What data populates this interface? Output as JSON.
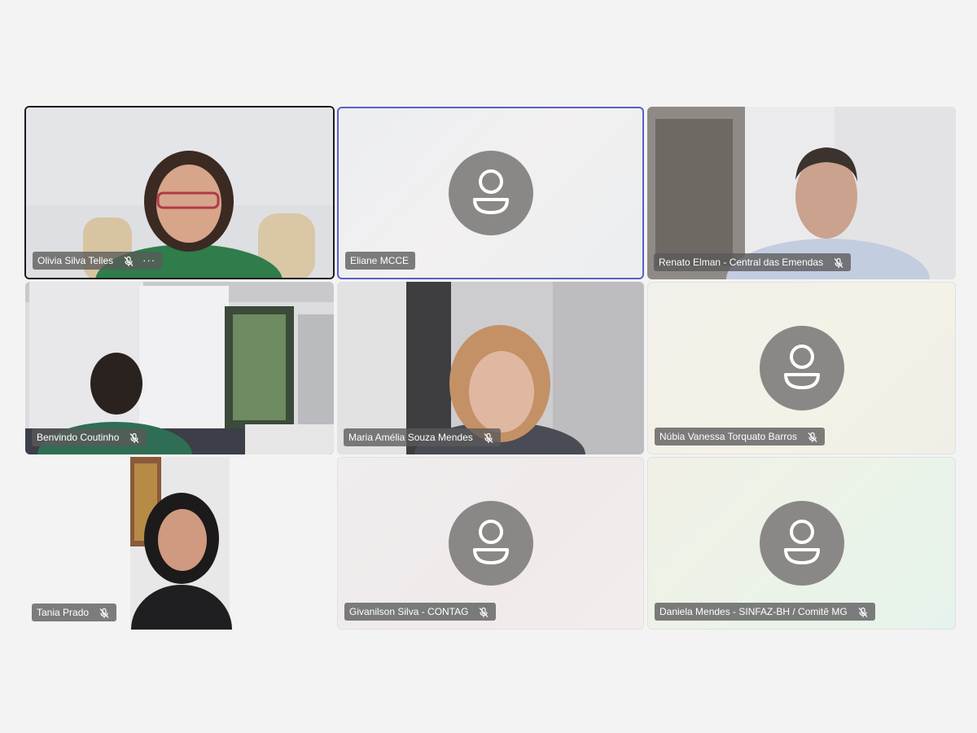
{
  "meeting": {
    "participants": [
      {
        "name": "Olivia Silva Telles",
        "muted": true,
        "more_label": "···",
        "state": "active"
      },
      {
        "name": "Eliane MCCE",
        "muted": false,
        "state": "speaking"
      },
      {
        "name": "Renato Elman - Central das Emendas",
        "muted": true,
        "state": "video"
      },
      {
        "name": "Benvindo Coutinho",
        "muted": true,
        "state": "video"
      },
      {
        "name": "Maria Amélia Souza Mendes",
        "muted": true,
        "state": "video"
      },
      {
        "name": "Núbia Vanessa Torquato Barros",
        "muted": true,
        "state": "avatar"
      },
      {
        "name": "Tania Prado",
        "muted": true,
        "state": "video"
      },
      {
        "name": "Givanilson Silva - CONTAG",
        "muted": true,
        "state": "avatar"
      },
      {
        "name": "Daniela Mendes - SINFAZ-BH / Comitê MG",
        "muted": true,
        "state": "avatar"
      }
    ]
  },
  "icons": {
    "mic_muted": "mic-off-icon",
    "avatar": "person-icon",
    "more": "more-icon"
  },
  "colors": {
    "speaking_border": "#5b5fc7",
    "active_border": "#1b1b1b",
    "avatar_bg": "#8a8886",
    "background": "#f3f3f3"
  }
}
